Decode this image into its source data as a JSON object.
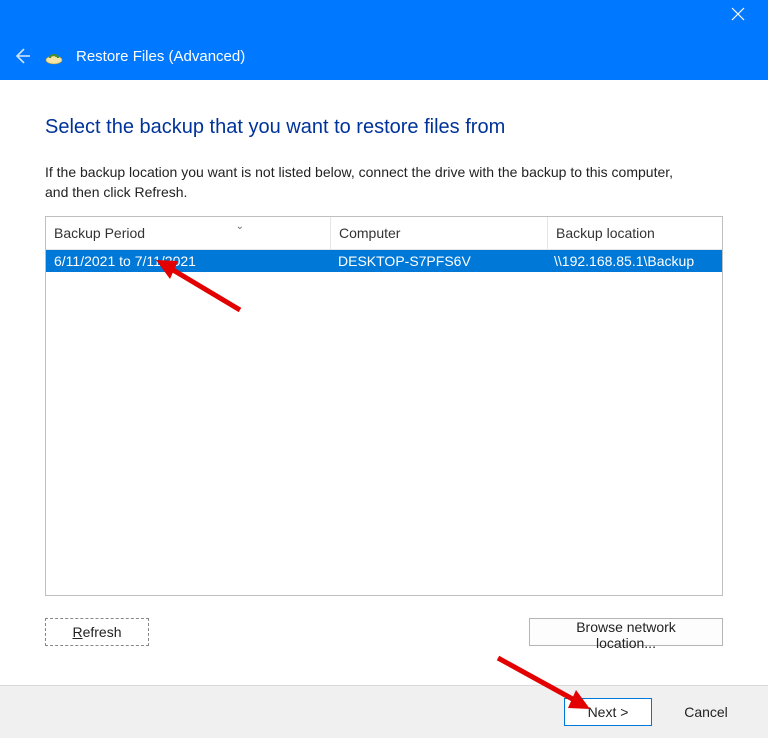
{
  "window": {
    "title": "Restore Files (Advanced)"
  },
  "page": {
    "heading": "Select the backup that you want to restore files from",
    "description": "If the backup location you want is not listed below, connect the drive with the backup to this computer, and then click Refresh."
  },
  "columns": {
    "period": "Backup Period",
    "computer": "Computer",
    "location": "Backup location"
  },
  "rows": [
    {
      "period": "6/11/2021 to 7/11/2021",
      "computer": "DESKTOP-S7PFS6V",
      "location": "\\\\192.168.85.1\\Backup"
    }
  ],
  "buttons": {
    "refresh_prefix": "R",
    "refresh_rest": "efresh",
    "browse": "Browse network location...",
    "next": "Next >",
    "cancel": "Cancel"
  }
}
